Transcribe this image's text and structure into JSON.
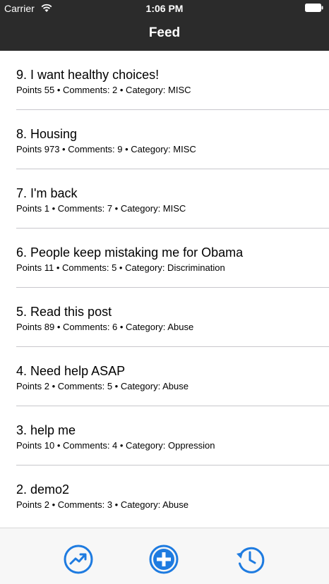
{
  "status_bar": {
    "carrier": "Carrier",
    "time": "1:06 PM"
  },
  "nav": {
    "title": "Feed"
  },
  "feed": [
    {
      "title": "9. I want healthy choices!",
      "meta": "Points 55 • Comments: 2 • Category: MISC"
    },
    {
      "title": "8. Housing",
      "meta": "Points 973 • Comments: 9 • Category: MISC"
    },
    {
      "title": "7. I'm back",
      "meta": "Points 1 • Comments: 7 • Category: MISC"
    },
    {
      "title": "6. People keep mistaking me for Obama",
      "meta": "Points 11 • Comments: 5 • Category: Discrimination"
    },
    {
      "title": "5. Read this post",
      "meta": "Points 89 • Comments: 6 • Category: Abuse"
    },
    {
      "title": "4. Need help ASAP",
      "meta": "Points 2 • Comments: 5 • Category: Abuse"
    },
    {
      "title": "3. help me",
      "meta": "Points 10 • Comments: 4 • Category: Oppression"
    },
    {
      "title": "2. demo2",
      "meta": "Points 2 • Comments: 3 • Category: Abuse"
    }
  ],
  "tabbar": {
    "items": [
      {
        "icon": "trending-icon"
      },
      {
        "icon": "add-circle-icon"
      },
      {
        "icon": "history-icon"
      }
    ]
  },
  "colors": {
    "nav_bg": "#2b2b2b",
    "accent": "#1e7be0",
    "divider": "#c8c7cc",
    "tabbar_bg": "#f7f7f7"
  }
}
